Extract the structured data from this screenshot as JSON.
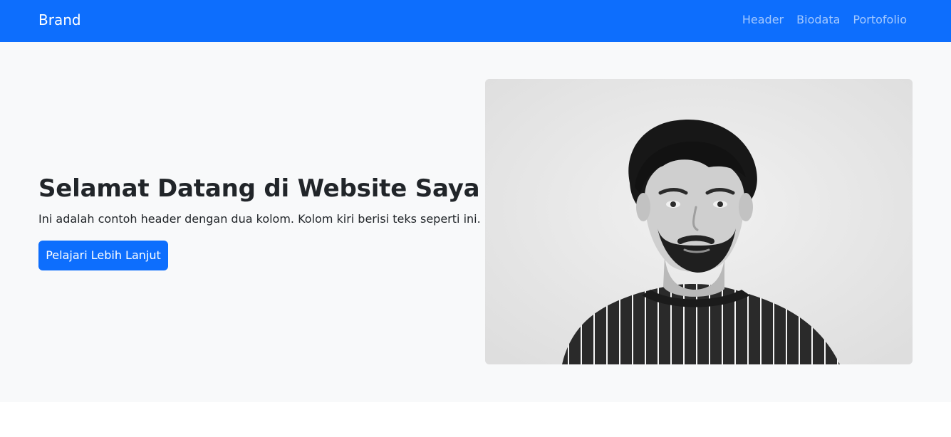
{
  "navbar": {
    "brand": "Brand",
    "links": [
      {
        "label": "Header"
      },
      {
        "label": "Biodata"
      },
      {
        "label": "Portofolio"
      }
    ],
    "colors": {
      "background": "#0d6efd",
      "brand_text": "#ffffff",
      "link_text": "rgba(255,255,255,0.62)"
    }
  },
  "hero": {
    "title": "Selamat Datang di Website Saya",
    "text": "Ini adalah contoh header dengan dua kolom. Kolom kiri berisi teks seperti ini.",
    "button_label": "Pelajari Lebih Lanjut",
    "image": {
      "subject": "black-and-white portrait of a man with curly hair and beard wearing a striped shirt"
    },
    "colors": {
      "background": "#f8f9fa",
      "title": "#212529",
      "button": "#0d6efd"
    }
  }
}
